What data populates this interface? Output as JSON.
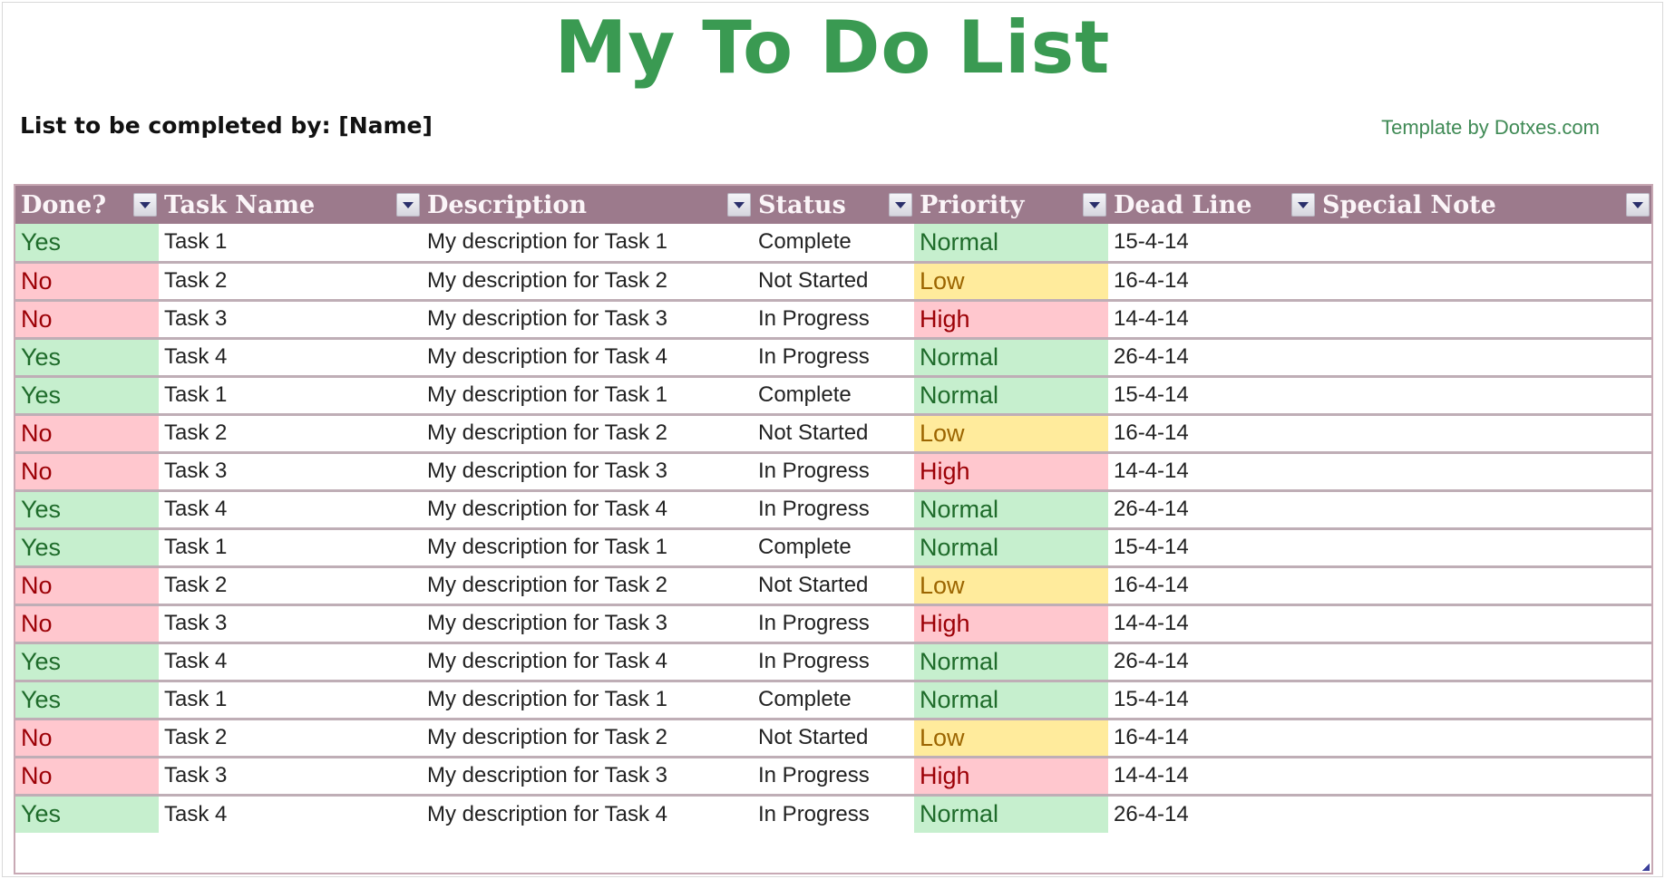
{
  "header": {
    "title": "My To Do List",
    "subtitle": "List to be completed by: [Name]",
    "credit": "Template by Dotxes.com"
  },
  "table": {
    "columns": [
      {
        "label": "Done?",
        "filter_icon": "dropdown-arrow-icon"
      },
      {
        "label": "Task Name",
        "filter_icon": "dropdown-arrow-icon"
      },
      {
        "label": "Description",
        "filter_icon": "dropdown-arrow-icon"
      },
      {
        "label": "Status",
        "filter_icon": "dropdown-arrow-icon"
      },
      {
        "label": "Priority",
        "filter_icon": "dropdown-arrow-icon"
      },
      {
        "label": "Dead Line",
        "filter_icon": "dropdown-arrow-icon"
      },
      {
        "label": "Special Note",
        "filter_icon": "dropdown-arrow-icon"
      }
    ],
    "rows": [
      {
        "done": "Yes",
        "task": "Task 1",
        "description": "My description for Task 1",
        "status": "Complete",
        "priority": "Normal",
        "deadline": "15-4-14",
        "note": ""
      },
      {
        "done": "No",
        "task": "Task 2",
        "description": "My description for Task 2",
        "status": "Not Started",
        "priority": "Low",
        "deadline": "16-4-14",
        "note": ""
      },
      {
        "done": "No",
        "task": "Task 3",
        "description": "My description for Task 3",
        "status": "In Progress",
        "priority": "High",
        "deadline": "14-4-14",
        "note": ""
      },
      {
        "done": "Yes",
        "task": "Task 4",
        "description": "My description for Task 4",
        "status": "In Progress",
        "priority": "Normal",
        "deadline": "26-4-14",
        "note": ""
      },
      {
        "done": "Yes",
        "task": "Task 1",
        "description": "My description for Task 1",
        "status": "Complete",
        "priority": "Normal",
        "deadline": "15-4-14",
        "note": ""
      },
      {
        "done": "No",
        "task": "Task 2",
        "description": "My description for Task 2",
        "status": "Not Started",
        "priority": "Low",
        "deadline": "16-4-14",
        "note": ""
      },
      {
        "done": "No",
        "task": "Task 3",
        "description": "My description for Task 3",
        "status": "In Progress",
        "priority": "High",
        "deadline": "14-4-14",
        "note": ""
      },
      {
        "done": "Yes",
        "task": "Task 4",
        "description": "My description for Task 4",
        "status": "In Progress",
        "priority": "Normal",
        "deadline": "26-4-14",
        "note": ""
      },
      {
        "done": "Yes",
        "task": "Task 1",
        "description": "My description for Task 1",
        "status": "Complete",
        "priority": "Normal",
        "deadline": "15-4-14",
        "note": ""
      },
      {
        "done": "No",
        "task": "Task 2",
        "description": "My description for Task 2",
        "status": "Not Started",
        "priority": "Low",
        "deadline": "16-4-14",
        "note": ""
      },
      {
        "done": "No",
        "task": "Task 3",
        "description": "My description for Task 3",
        "status": "In Progress",
        "priority": "High",
        "deadline": "14-4-14",
        "note": ""
      },
      {
        "done": "Yes",
        "task": "Task 4",
        "description": "My description for Task 4",
        "status": "In Progress",
        "priority": "Normal",
        "deadline": "26-4-14",
        "note": ""
      },
      {
        "done": "Yes",
        "task": "Task 1",
        "description": "My description for Task 1",
        "status": "Complete",
        "priority": "Normal",
        "deadline": "15-4-14",
        "note": ""
      },
      {
        "done": "No",
        "task": "Task 2",
        "description": "My description for Task 2",
        "status": "Not Started",
        "priority": "Low",
        "deadline": "16-4-14",
        "note": ""
      },
      {
        "done": "No",
        "task": "Task 3",
        "description": "My description for Task 3",
        "status": "In Progress",
        "priority": "High",
        "deadline": "14-4-14",
        "note": ""
      },
      {
        "done": "Yes",
        "task": "Task 4",
        "description": "My description for Task 4",
        "status": "In Progress",
        "priority": "Normal",
        "deadline": "26-4-14",
        "note": ""
      }
    ]
  },
  "colors": {
    "title_green": "#3a9a52",
    "header_mauve": "#9c7a8c",
    "yes_fill": "#c6efce",
    "yes_text": "#1e6b2a",
    "no_fill": "#ffc7ce",
    "no_text": "#9c0006",
    "low_fill": "#ffeb9c",
    "low_text": "#9c6500"
  }
}
